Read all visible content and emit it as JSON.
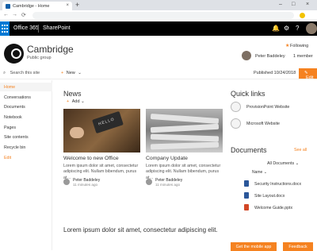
{
  "browser": {
    "tab_title": "Cambridge - Home",
    "new_tab_symbol": "+",
    "close_symbol": "×",
    "nav": {
      "back": "←",
      "forward": "→",
      "reload": "⟳"
    },
    "url": "",
    "window_controls": [
      "–",
      "□",
      "×"
    ]
  },
  "suite": {
    "app_name": "Office 365",
    "product": "SharePoint",
    "icons": [
      "bell-icon",
      "gear-icon",
      "help-icon"
    ],
    "icon_glyphs": [
      "🔔",
      "⚙",
      "?"
    ]
  },
  "site": {
    "name": "Cambridge",
    "subtitle": "Public group",
    "following_label": "Following",
    "following_star": "★",
    "owner_name": "Peter Baddeley",
    "members_label": "1 member"
  },
  "command_bar": {
    "search_placeholder": "Search this site",
    "search_icon": "⌕",
    "new_label": "New",
    "published": "Published 10/24/2018",
    "edit_label": "Edit"
  },
  "left_nav": [
    {
      "label": "Home",
      "selected": true
    },
    {
      "label": "Conversations"
    },
    {
      "label": "Documents"
    },
    {
      "label": "Notebook"
    },
    {
      "label": "Pages"
    },
    {
      "label": "Site contents"
    },
    {
      "label": "Recycle bin"
    },
    {
      "label": "Edit",
      "accent": true
    }
  ],
  "news": {
    "title": "News",
    "add_label": "Add",
    "items": [
      {
        "title": "Welcome to new Office",
        "body": "Lorem ipsum dolor sit amet, consectetur adipiscing elit. Nullam bibendum, purus at…",
        "author": "Peter Baddeley",
        "ago": "11 minutes ago",
        "image": "chalkboard-hello"
      },
      {
        "title": "Company Update",
        "body": "Lorem ipsum dolor sit amet, consectetur adipiscing elit. Nullam bibendum, purus at…",
        "author": "Peter Baddeley",
        "ago": "11 minutes ago",
        "image": "newspapers"
      }
    ],
    "bottom_text": "Lorem ipsum dolor sit amet, consectetur adipiscing elit."
  },
  "quick_links": {
    "title": "Quick links",
    "items": [
      {
        "label": "ProvisionPoint Website",
        "icon": "globe-icon"
      },
      {
        "label": "Microsoft Website",
        "icon": "globe-icon"
      }
    ]
  },
  "documents": {
    "title": "Documents",
    "see_all": "See all",
    "library_label": "All Documents",
    "column_name": "Name",
    "files": [
      {
        "name": "Security Instructions.docx",
        "type": "word"
      },
      {
        "name": "Site Layout.docx",
        "type": "word"
      },
      {
        "name": "Welcome Guide.pptx",
        "type": "powerpoint"
      }
    ]
  },
  "footer": {
    "mobile_app": "Get the mobile app",
    "feedback": "Feedback"
  },
  "colors": {
    "accent": "#f58220",
    "suite_bar": "#000000",
    "waffle": "#0078d4"
  }
}
